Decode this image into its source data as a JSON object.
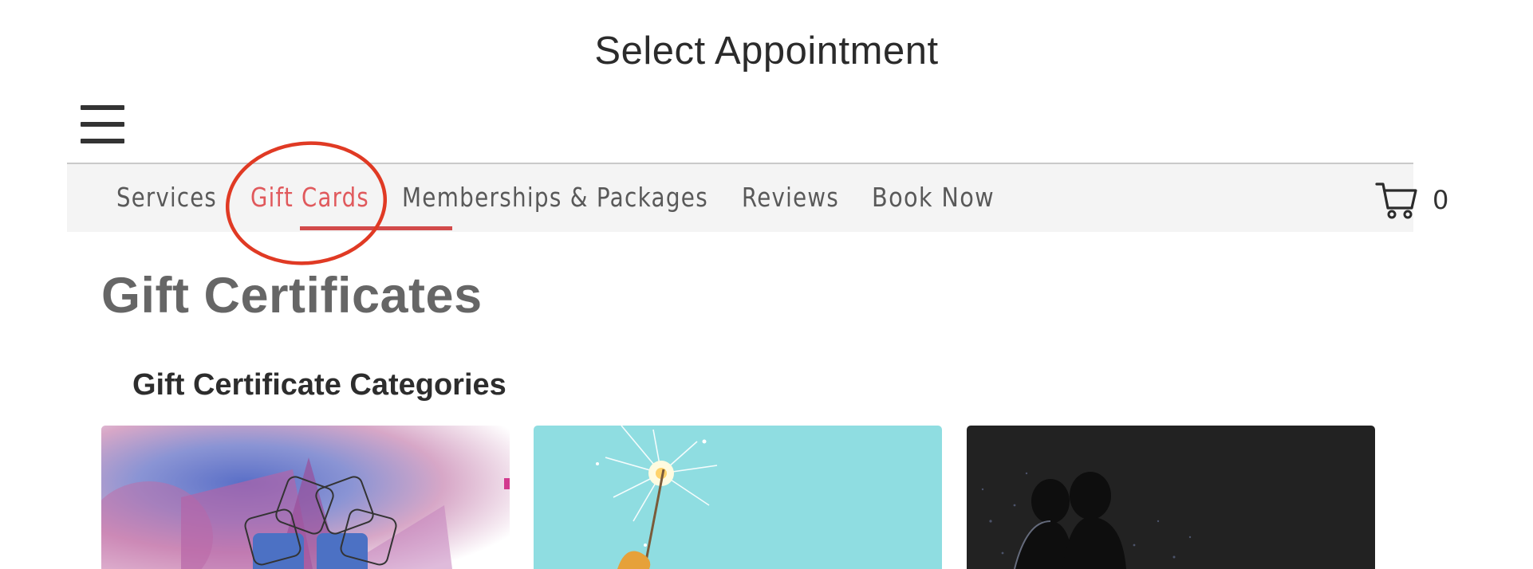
{
  "header": {
    "title": "Select Appointment"
  },
  "nav": {
    "items": [
      {
        "label": "Services"
      },
      {
        "label": "Gift Cards",
        "active": true
      },
      {
        "label": "Memberships & Packages"
      },
      {
        "label": "Reviews"
      },
      {
        "label": "Book Now"
      }
    ],
    "cart_count": "0",
    "active_color": "#e0595c",
    "annotation_color": "#e03a24"
  },
  "main": {
    "title": "Gift Certificates",
    "subtitle": "Gift Certificate Categories"
  },
  "icons": [
    "menu-icon",
    "cart-icon"
  ]
}
